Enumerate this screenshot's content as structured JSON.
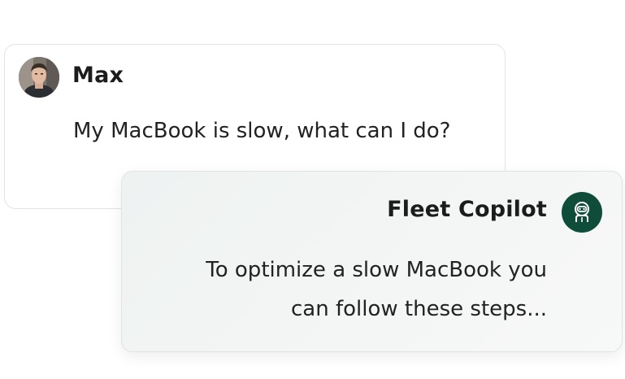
{
  "user_message": {
    "sender": "Max",
    "avatar_icon": "user-photo-avatar",
    "text": "My MacBook is slow, what can I do?"
  },
  "assistant_message": {
    "sender": "Fleet Copilot",
    "avatar_icon": "robot-astronaut-icon",
    "avatar_color": "#0f4d3a",
    "lines": [
      "To optimize a slow MacBook you",
      "can follow these steps..."
    ]
  }
}
